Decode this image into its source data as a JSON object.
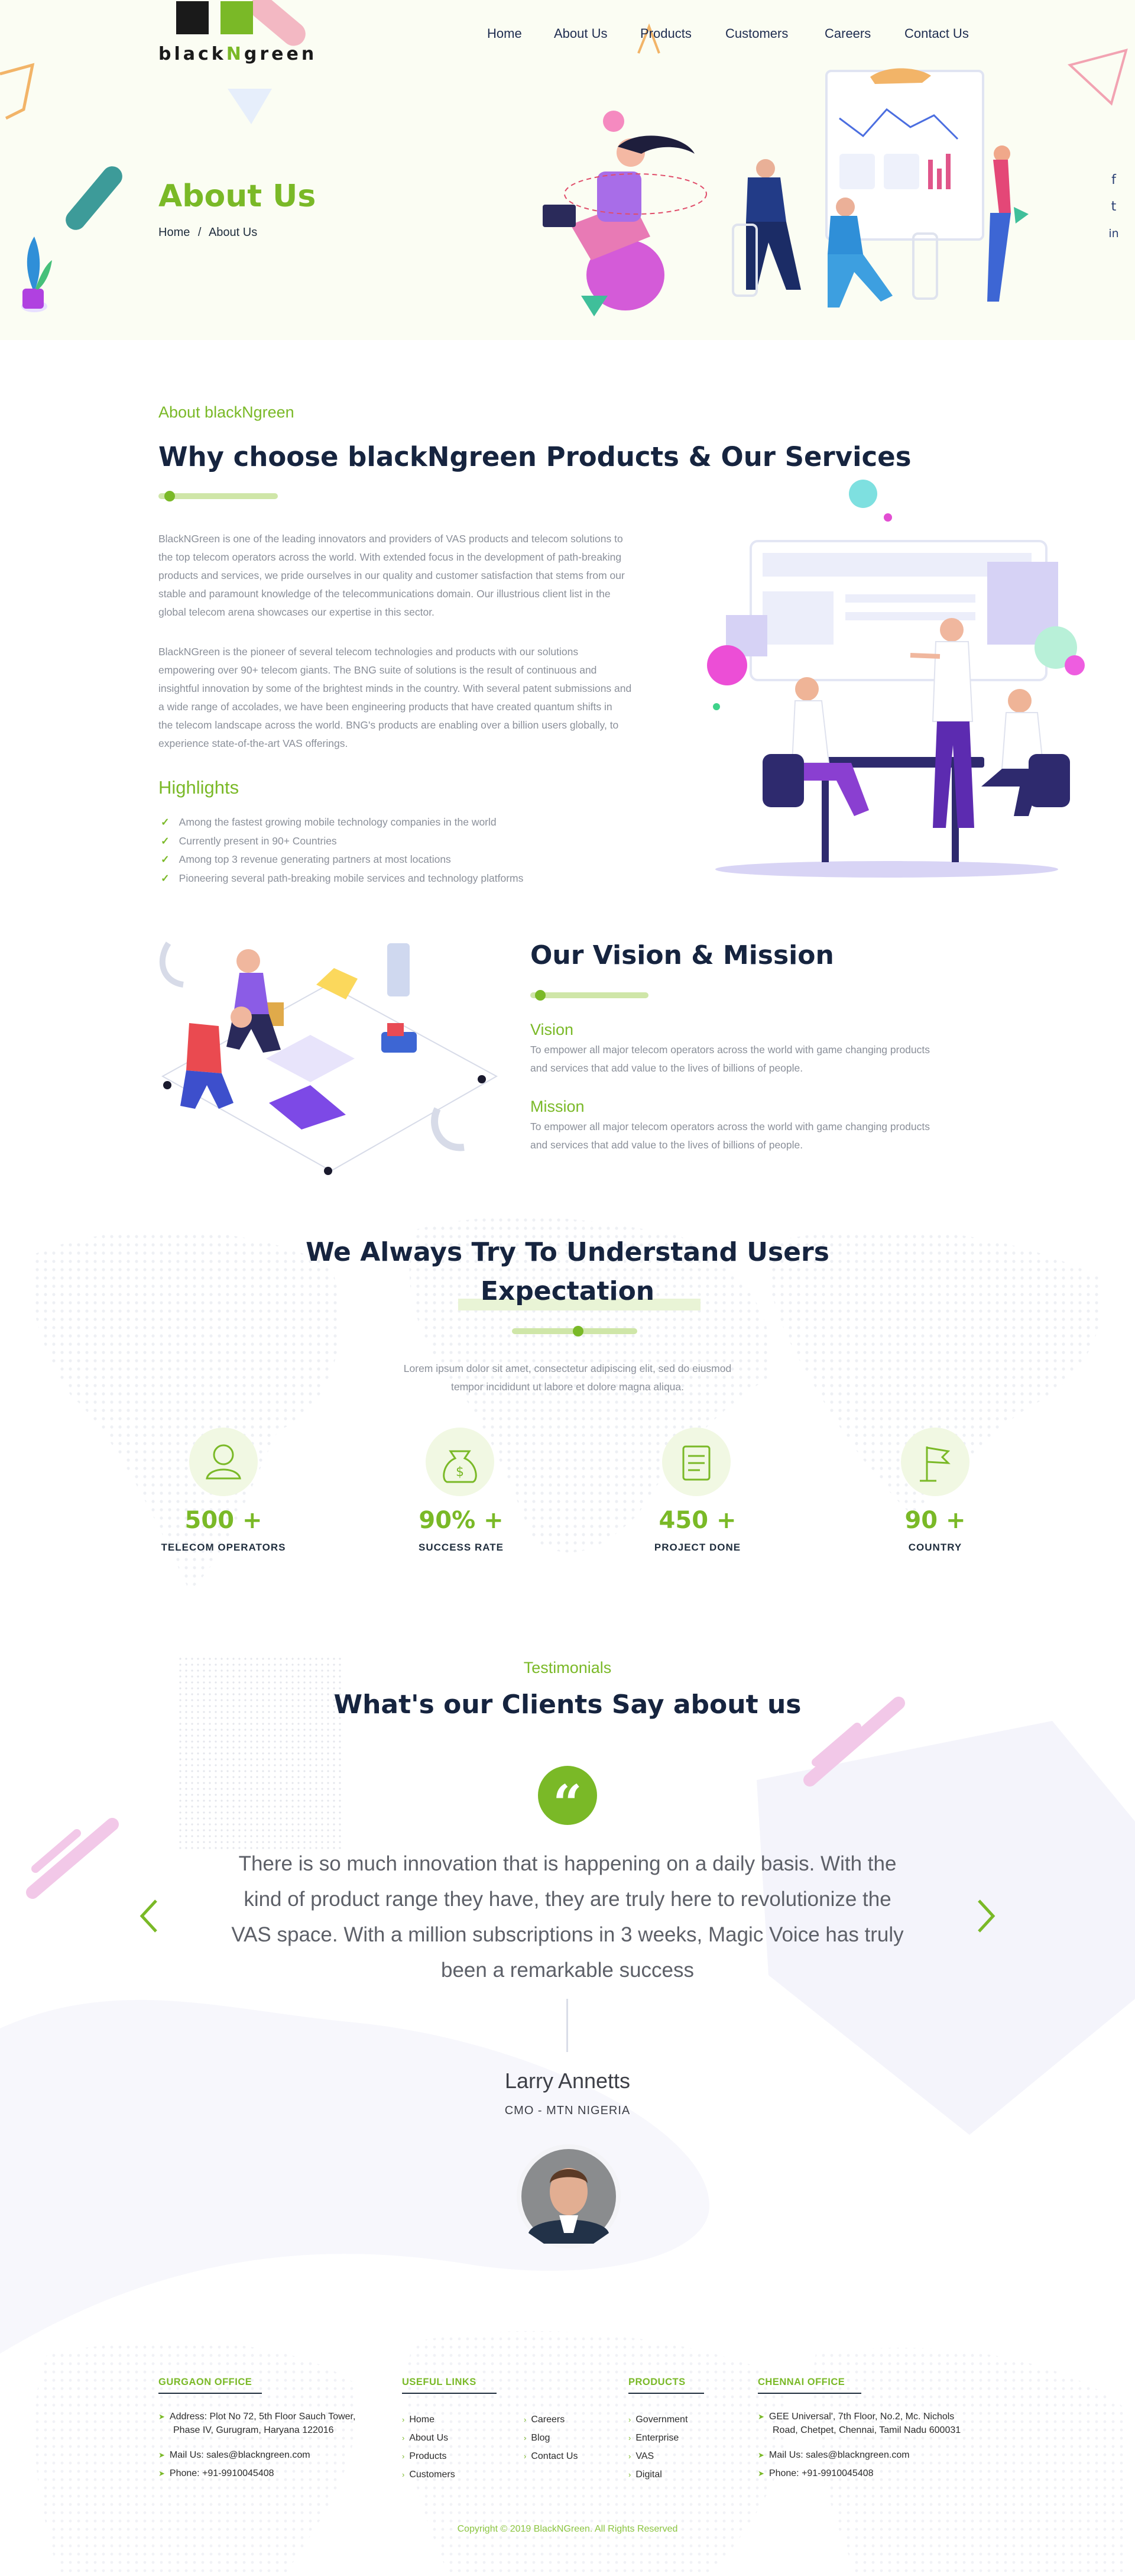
{
  "brand": {
    "logo_text_a": "black",
    "logo_text_b": "N",
    "logo_text_c": "green"
  },
  "nav": {
    "items": [
      "Home",
      "About Us",
      "Products",
      "Customers",
      "Careers",
      "Contact Us"
    ]
  },
  "hero": {
    "title": "About Us",
    "breadcrumb_home": "Home",
    "breadcrumb_sep": "/",
    "breadcrumb_current": "About Us"
  },
  "social": {
    "facebook": "f",
    "twitter": "t",
    "linkedin": "in"
  },
  "about": {
    "eyebrow": "About blackNgreen",
    "title": "Why choose blackNgreen Products & Our Services",
    "para1": [
      "BlackNGreen is one of the leading innovators and providers of VAS products and telecom solutions to",
      "the top telecom operators across the world. With extended focus in the development of path-breaking",
      "products and services, we pride ourselves in our quality and customer satisfaction that stems from our",
      "stable and paramount knowledge of the telecommunications domain. Our illustrious client list in the",
      "global telecom arena showcases our expertise in this sector."
    ],
    "para2": [
      "BlackNGreen is the pioneer of several telecom technologies and products with our solutions",
      "empowering over 90+ telecom giants. The BNG suite of solutions is the result of continuous and",
      "insightful innovation by some of the brightest minds in the country. With several patent submissions and",
      "a wide range of accolades, we have been engineering products that have created quantum shifts in",
      "the telecom landscape across the world. BNG's products are enabling over a billion users globally, to",
      "experience state-of-the-art VAS offerings."
    ],
    "highlights_title": "Highlights",
    "highlights": [
      "Among the fastest growing mobile technology companies in the world",
      "Currently present in 90+ Countries",
      "Among top 3 revenue generating partners at most locations",
      "Pioneering several path-breaking mobile services and technology platforms"
    ]
  },
  "vision": {
    "title": "Our Vision & Mission",
    "vision_title": "Vision",
    "vision_text": [
      "To empower all major telecom operators across the world with game changing products",
      "and services that add value to the lives of billions of people."
    ],
    "mission_title": "Mission",
    "mission_text": [
      "To empower all major telecom operators across the world with game changing products",
      "and services that add value to the lives of billions of people."
    ]
  },
  "stats": {
    "title_l1": "We Always Try To Understand Users",
    "title_l2": "Expectation",
    "subtitle_l1": "Lorem ipsum dolor sit amet, consectetur adipiscing elit, sed do eiusmod",
    "subtitle_l2": "tempor incididunt ut labore et dolore magna aliqua.",
    "items": [
      {
        "value": "500 +",
        "label": "TELECOM OPERATORS",
        "icon": "user-icon"
      },
      {
        "value": "90% +",
        "label": "SUCCESS RATE",
        "icon": "money-bag-icon"
      },
      {
        "value": "450 +",
        "label": "PROJECT DONE",
        "icon": "clipboard-icon"
      },
      {
        "value": "90 +",
        "label": "COUNTRY",
        "icon": "flag-icon"
      }
    ]
  },
  "testimonials": {
    "eyebrow": "Testimonials",
    "title": "What's our Clients Say about us",
    "quote": [
      "There is so much innovation that is happening on a daily basis. With the",
      "kind of product range they have, they are truly here to revolutionize the",
      "VAS space. With a million subscriptions in 3 weeks, Magic Voice has truly",
      "been a remarkable success"
    ],
    "name": "Larry Annetts",
    "role": "CMO - MTN NIGERIA"
  },
  "footer": {
    "gurgaon": {
      "title": "GURGAON OFFICE",
      "addr_l1": "Address:  Plot No 72, 5th Floor Sauch Tower,",
      "addr_l2": "Phase IV, Gurugram, Haryana 122016",
      "mail": "Mail Us:  sales@blackngreen.com",
      "phone": "Phone:  +91-9910045408"
    },
    "useful": {
      "title": "USEFUL LINKS",
      "col1": [
        "Home",
        "About Us",
        "Products",
        "Customers"
      ],
      "col2": [
        "Careers",
        "Blog",
        "Contact Us"
      ]
    },
    "products": {
      "title": "PRODUCTS",
      "items": [
        "Government",
        "Enterprise",
        "VAS",
        "Digital"
      ]
    },
    "chennai": {
      "title": "CHENNAI OFFICE",
      "addr_l1": "GEE Universal', 7th Floor, No.2, Mc. Nichols",
      "addr_l2": "Road, Chetpet, Chennai, Tamil Nadu 600031",
      "mail": "Mail Us:  sales@blackngreen.com",
      "phone": "Phone:  +91-9910045408"
    },
    "copyright": "Copyright © 2019 BlackNGreen. All Rights Reserved"
  },
  "colors": {
    "accent": "#7ab927",
    "navy": "#16243f",
    "hero_bg": "#fbfdf3"
  }
}
